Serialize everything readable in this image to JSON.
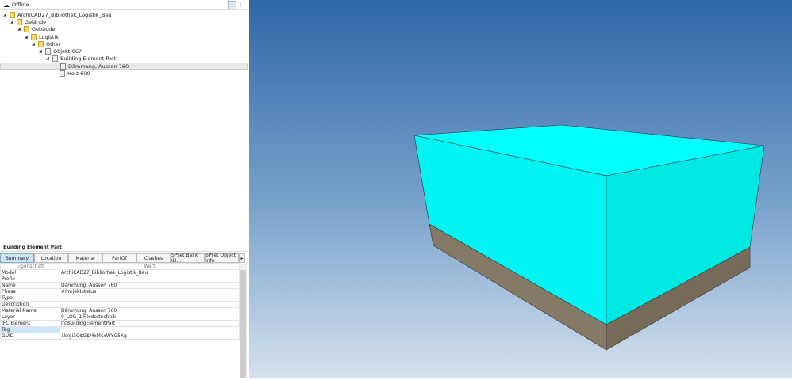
{
  "status": "Offline",
  "tree": [
    {
      "label": "ArchiCAD27_Bibliothek_Logistik_Bau",
      "level": 0
    },
    {
      "label": "Gelände",
      "level": 1
    },
    {
      "label": "Gebäude",
      "level": 2
    },
    {
      "label": "Logistik",
      "level": 3
    },
    {
      "label": "Other",
      "level": 4
    },
    {
      "label": "Objekt-067",
      "level": 5
    },
    {
      "label": "Building Element Part",
      "level": 6
    },
    {
      "label": "Dämmung, Aussen 760",
      "level": 7,
      "selected": true
    },
    {
      "label": "Holz 600",
      "level": 7
    }
  ],
  "properties": {
    "title": "Building Element Part",
    "tabs": [
      "Summary",
      "Location",
      "Material",
      "PartOf",
      "Clashes",
      "SPset Basic ID...",
      "SPset Object Info"
    ],
    "col_key": "Eigenschaft",
    "col_val": "Wert",
    "rows": [
      [
        "Model",
        "ArchiCAD27_Bibliothek_Logistik_Bau"
      ],
      [
        "Prefix",
        ""
      ],
      [
        "Name",
        "Dämmung, Aussen 760"
      ],
      [
        "Phase",
        "#Projektstatus"
      ],
      [
        "Type",
        ""
      ],
      [
        "Description",
        ""
      ],
      [
        "Material Name",
        "Dämmung, Aussen 760"
      ],
      [
        "Layer",
        "0_LOG_1 Fördertechnik"
      ],
      [
        "IFC Element",
        "IfcBuildingElementPart"
      ],
      [
        "Tag",
        ""
      ],
      [
        "GUID",
        "1krgi3Q$G$Mxl4sxWYG5Xg"
      ]
    ]
  },
  "colors": {
    "insulation": "#00ffff",
    "wood": "#857a66"
  }
}
